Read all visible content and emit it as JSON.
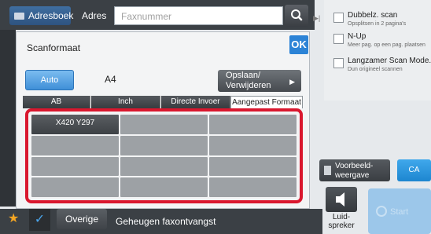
{
  "topbar": {
    "addressbook_label": "Adresboek",
    "address_label": "Adres",
    "fax_placeholder": "Faxnummer"
  },
  "dialog": {
    "title": "Scanformaat",
    "ok_label": "OK",
    "auto_label": "Auto",
    "size_value": "A4",
    "save_label_line1": "Opslaan/",
    "save_label_line2": "Verwijderen",
    "tabs": [
      {
        "label": "AB"
      },
      {
        "label": "Inch"
      },
      {
        "label": "Directe Invoer"
      },
      {
        "label": "Aangepast Formaat"
      }
    ],
    "grid": [
      "X420 Y297",
      "",
      "",
      "",
      "",
      "",
      "",
      "",
      "",
      "",
      "",
      ""
    ]
  },
  "right_panel": {
    "options": [
      {
        "title": "Dubbelz. scan",
        "subtitle": "Opsplitsen in 2 pagina's"
      },
      {
        "title": "N-Up",
        "subtitle": "Meer pag. op een pag. plaatsen"
      },
      {
        "title": "Langzamer Scan Mode.",
        "subtitle": "Dun origineel scannen"
      }
    ],
    "preview_line1": "Voorbeeld-",
    "preview_line2": "weergave",
    "ca_label": "CA",
    "speaker_line1": "Luid-",
    "speaker_line2": "spreker",
    "start_label": "Start"
  },
  "bottombar": {
    "other_label": "Overige",
    "memory_label": "Geheugen faxontvangst"
  },
  "colors": {
    "accent_blue": "#2c83d6",
    "highlight_red": "#d9172e",
    "dark_bar": "#3b4045"
  }
}
